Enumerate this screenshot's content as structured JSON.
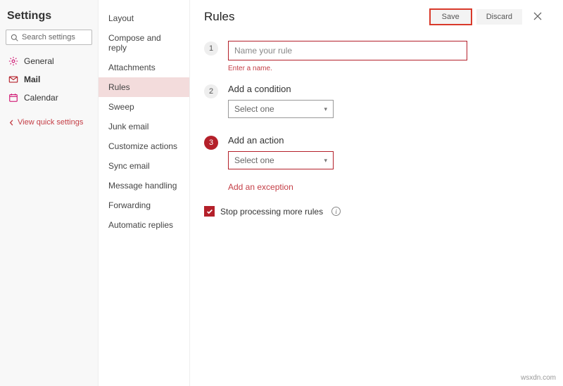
{
  "settings_title": "Settings",
  "search_placeholder": "Search settings",
  "left_nav": {
    "general": "General",
    "mail": "Mail",
    "calendar": "Calendar",
    "quick": "View quick settings"
  },
  "mid_nav": [
    "Layout",
    "Compose and reply",
    "Attachments",
    "Rules",
    "Sweep",
    "Junk email",
    "Customize actions",
    "Sync email",
    "Message handling",
    "Forwarding",
    "Automatic replies"
  ],
  "main": {
    "title": "Rules",
    "save": "Save",
    "discard": "Discard",
    "step1_placeholder": "Name your rule",
    "step1_error": "Enter a name.",
    "step2_title": "Add a condition",
    "step2_select": "Select one",
    "step3_title": "Add an action",
    "step3_select": "Select one",
    "add_exception": "Add an exception",
    "stop_processing": "Stop processing more rules"
  },
  "watermark": "wsxdn.com"
}
